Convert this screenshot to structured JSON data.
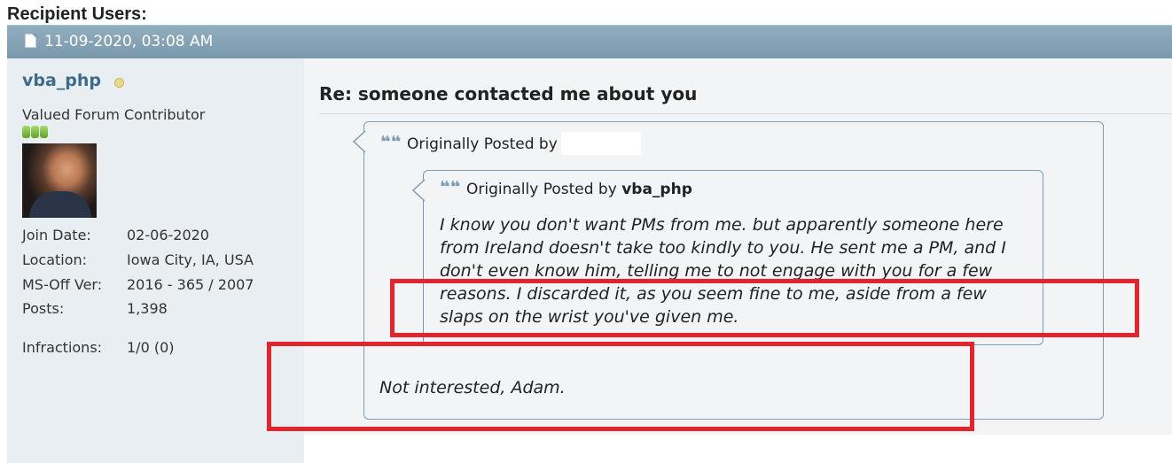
{
  "header": {
    "recipient_label": "Recipient Users:"
  },
  "post": {
    "date": "11-09-2020, 03:08 AM",
    "title": "Re: someone contacted me about you",
    "reply_text": "Not interested, Adam."
  },
  "user": {
    "username": "vba_php",
    "title": "Valued Forum Contributor",
    "reputation_pips": 3,
    "stats": [
      {
        "label": "Join Date:",
        "value": "02-06-2020"
      },
      {
        "label": "Location:",
        "value": "Iowa City, IA, USA"
      },
      {
        "label": "MS-Off Ver:",
        "value": "2016 - 365 / 2007"
      },
      {
        "label": "Posts:",
        "value": "1,398"
      },
      {
        "label": "Infractions:",
        "value": "1/0 (0)"
      }
    ]
  },
  "outer_quote": {
    "prefix": "Originally Posted by",
    "author": ""
  },
  "inner_quote": {
    "prefix": "Originally Posted by",
    "author": "vba_php",
    "lines": [
      "I know you don't want PMs from me. but apparently someone here",
      "from Ireland doesn't take too kindly to you. He sent me a PM, and I",
      "don't even know him, telling me to not engage with you for a few",
      "reasons. I discarded it, as you seem fine to me, aside from a few",
      "slaps on the wrist you've given me."
    ]
  },
  "colors": {
    "post_bar": "#7a98ac",
    "username": "#3e6b8a",
    "quote_border": "#7e9db5",
    "highlight": "#e1242e"
  }
}
